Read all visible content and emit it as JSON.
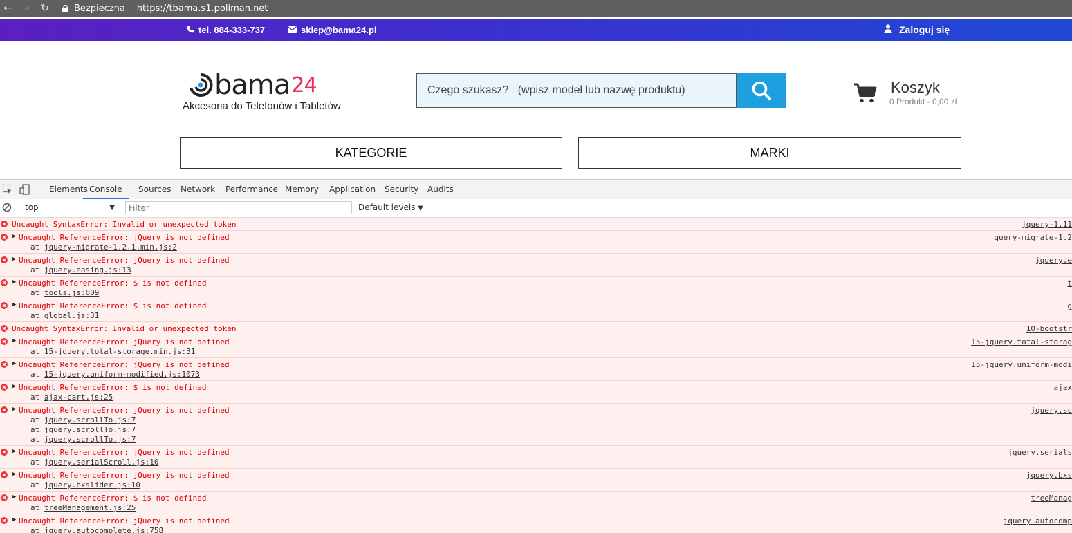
{
  "browser": {
    "secure_label": "Bezpieczna",
    "url": "https://tbama.s1.poliman.net"
  },
  "topbar": {
    "phone": "tel. 884-333-737",
    "email": "sklep@bama24.pl",
    "login": "Zaloguj się"
  },
  "header": {
    "logo_word": "bama",
    "logo_num": "24",
    "tagline": "Akcesoria do Telefonów i Tabletów",
    "search_placeholder": "Czego szukasz?   (wpisz model lub nazwę produktu)",
    "cart_title": "Koszyk",
    "cart_summary": "0 Produkt - 0,00 zł"
  },
  "nav": {
    "categories": "KATEGORIE",
    "brands": "MARKI"
  },
  "devtools": {
    "tabs": [
      "Elements",
      "Console",
      "Sources",
      "Network",
      "Performance",
      "Memory",
      "Application",
      "Security",
      "Audits"
    ],
    "context": "top",
    "filter_placeholder": "Filter",
    "levels": "Default levels",
    "log": [
      {
        "msg": "Uncaught SyntaxError: Invalid or unexpected token",
        "expandable": false,
        "stack": [],
        "src": "jquery-1.11"
      },
      {
        "msg": "Uncaught ReferenceError: jQuery is not defined",
        "expandable": true,
        "stack": [
          "jquery-migrate-1.2.1.min.js:2"
        ],
        "src": "jquery-migrate-1.2"
      },
      {
        "msg": "Uncaught ReferenceError: jQuery is not defined",
        "expandable": true,
        "stack": [
          "jquery.easing.js:13"
        ],
        "src": "jquery.e"
      },
      {
        "msg": "Uncaught ReferenceError: $ is not defined",
        "expandable": true,
        "stack": [
          "tools.js:609"
        ],
        "src": "t"
      },
      {
        "msg": "Uncaught ReferenceError: $ is not defined",
        "expandable": true,
        "stack": [
          "global.js:31"
        ],
        "src": "g"
      },
      {
        "msg": "Uncaught SyntaxError: Invalid or unexpected token",
        "expandable": false,
        "stack": [],
        "src": "10-bootstr"
      },
      {
        "msg": "Uncaught ReferenceError: jQuery is not defined",
        "expandable": true,
        "stack": [
          "15-jquery.total-storage.min.js:31"
        ],
        "src": "15-jquery.total-storag"
      },
      {
        "msg": "Uncaught ReferenceError: jQuery is not defined",
        "expandable": true,
        "stack": [
          "15-jquery.uniform-modified.js:1073"
        ],
        "src": "15-jquery.uniform-modi"
      },
      {
        "msg": "Uncaught ReferenceError: $ is not defined",
        "expandable": true,
        "stack": [
          "ajax-cart.js:25"
        ],
        "src": "ajax"
      },
      {
        "msg": "Uncaught ReferenceError: jQuery is not defined",
        "expandable": true,
        "stack": [
          "jquery.scrollTo.js:7",
          "jquery.scrollTo.js:7",
          "jquery.scrollTo.js:7"
        ],
        "src": "jquery.sc"
      },
      {
        "msg": "Uncaught ReferenceError: jQuery is not defined",
        "expandable": true,
        "stack": [
          "jquery.serialScroll.js:10"
        ],
        "src": "jquery.serials"
      },
      {
        "msg": "Uncaught ReferenceError: jQuery is not defined",
        "expandable": true,
        "stack": [
          "jquery.bxslider.js:10"
        ],
        "src": "jquery.bxs"
      },
      {
        "msg": "Uncaught ReferenceError: $ is not defined",
        "expandable": true,
        "stack": [
          "treeManagement.js:25"
        ],
        "src": "treeManag"
      },
      {
        "msg": "Uncaught ReferenceError: jQuery is not defined",
        "expandable": true,
        "stack": [
          "jquery.autocomplete.js:758"
        ],
        "src": "jquery.autocomp"
      }
    ]
  },
  "colors": {
    "topbar_start": "#5b1fc0",
    "topbar_end": "#1f49d4",
    "search_button": "#1e9fe0",
    "logo_accent": "#e8305e",
    "error_text": "#e00000",
    "error_bg": "#fff0f0"
  }
}
